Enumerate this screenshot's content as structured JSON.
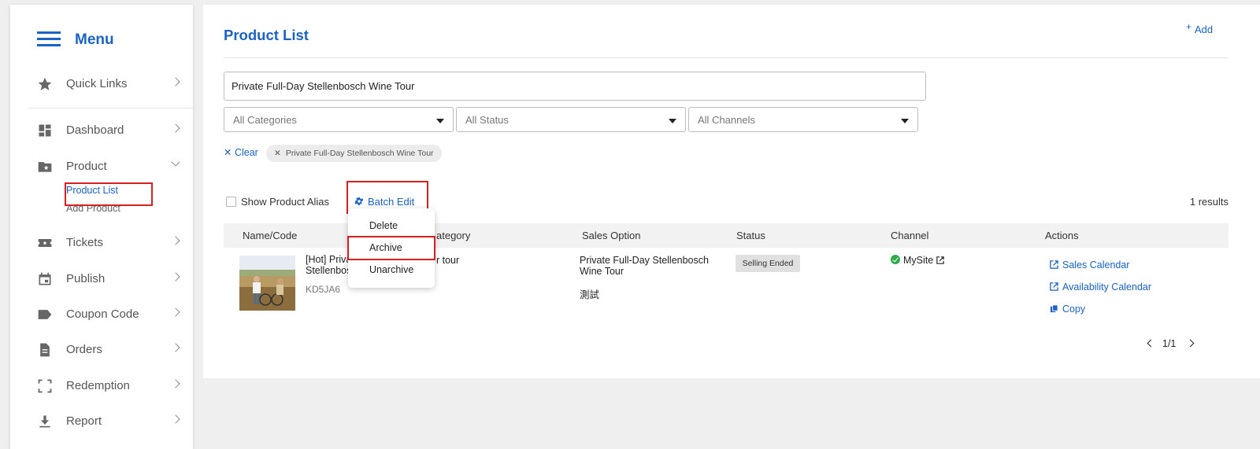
{
  "sidebar": {
    "title": "Menu",
    "items": [
      {
        "label": "Quick Links",
        "icon": "star-icon"
      },
      {
        "label": "Dashboard",
        "icon": "dashboard-icon"
      },
      {
        "label": "Product",
        "icon": "folder-star-icon"
      },
      {
        "label": "Tickets",
        "icon": "ticket-icon"
      },
      {
        "label": "Publish",
        "icon": "calendar-icon"
      },
      {
        "label": "Coupon Code",
        "icon": "tag-icon"
      },
      {
        "label": "Orders",
        "icon": "document-icon"
      },
      {
        "label": "Redemption",
        "icon": "scan-icon"
      },
      {
        "label": "Report",
        "icon": "download-icon"
      }
    ],
    "product_sub": [
      "Product List",
      "Add Product"
    ]
  },
  "main": {
    "title": "Product List",
    "add_label": "Add",
    "search_value": "Private Full-Day Stellenbosch Wine Tour",
    "filters": [
      "All Categories",
      "All Status",
      "All Channels"
    ],
    "clear_label": "Clear",
    "chip_label": "Private Full-Day Stellenbosch Wine Tour",
    "show_alias_label": "Show Product Alias",
    "batch_edit_label": "Batch Edit",
    "results_label": "1 results",
    "columns": [
      "Name/Code",
      "ategory",
      "Sales Option",
      "Status",
      "Channel",
      "Actions"
    ],
    "row": {
      "name": "[Hot] Privat Stellenbosc",
      "code": "KD5JA6",
      "category": "r tour",
      "sales_option": "Private Full-Day Stellenbosch Wine Tour",
      "sales_option_2": "測試",
      "status": "Selling Ended",
      "channel": "MySite",
      "actions": [
        "Sales Calendar",
        "Availability Calendar",
        "Copy"
      ]
    },
    "pagination": "1/1",
    "batch_menu": [
      "Delete",
      "Archive",
      "Unarchive"
    ]
  },
  "colors": {
    "accent": "#1a62c4",
    "highlight": "#d92020",
    "success": "#2fab4c"
  }
}
